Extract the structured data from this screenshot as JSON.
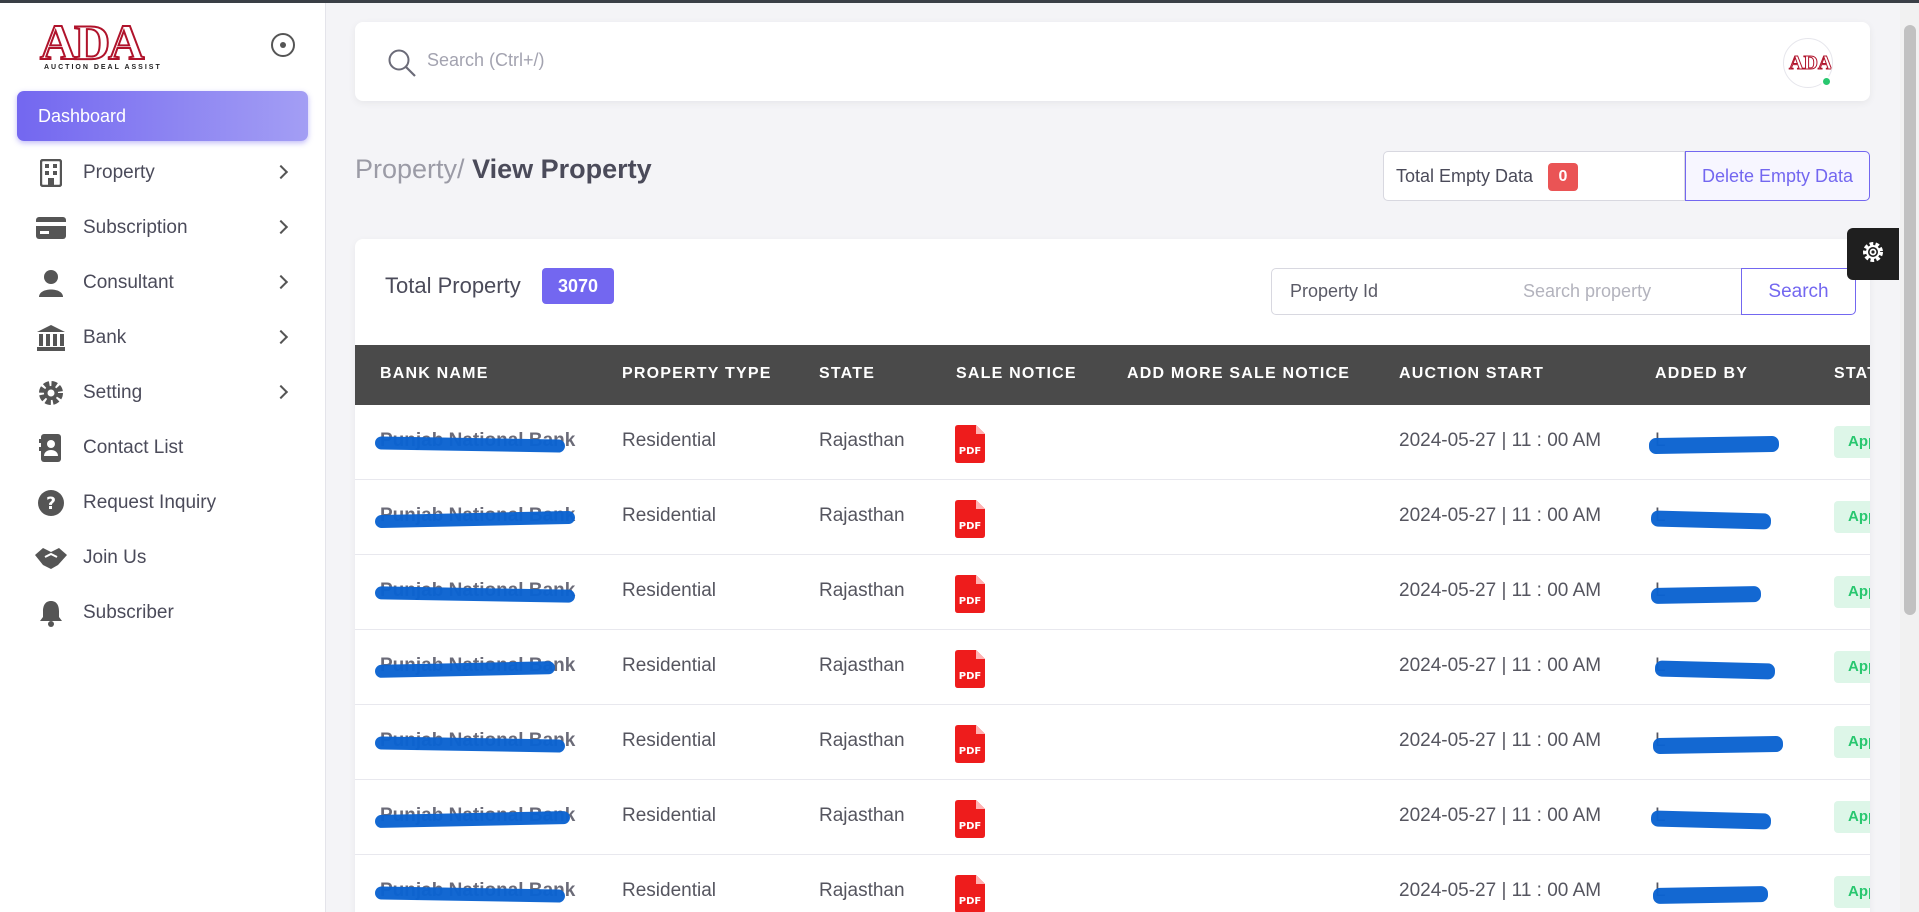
{
  "brand": {
    "logo_text": "ADA",
    "tagline": "AUCTION DEAL ASSIST"
  },
  "sidebar": {
    "active": "Dashboard",
    "items": [
      {
        "label": "Property",
        "icon": "building-icon",
        "has_submenu": true
      },
      {
        "label": "Subscription",
        "icon": "credit-card-icon",
        "has_submenu": true
      },
      {
        "label": "Consultant",
        "icon": "user-icon",
        "has_submenu": true
      },
      {
        "label": "Bank",
        "icon": "bank-icon",
        "has_submenu": true
      },
      {
        "label": "Setting",
        "icon": "gear-icon",
        "has_submenu": true
      },
      {
        "label": "Contact List",
        "icon": "contact-card-icon",
        "has_submenu": false
      },
      {
        "label": "Request Inquiry",
        "icon": "question-icon",
        "has_submenu": false
      },
      {
        "label": "Join Us",
        "icon": "handshake-icon",
        "has_submenu": false
      },
      {
        "label": "Subscriber",
        "icon": "bell-icon",
        "has_submenu": false
      }
    ]
  },
  "topbar": {
    "search_placeholder": "Search (Ctrl+/)"
  },
  "breadcrumb": {
    "parent": "Property/",
    "current": "View Property"
  },
  "empty_data": {
    "label": "Total Empty Data",
    "count": "0",
    "delete_label": "Delete Empty Data"
  },
  "property_card": {
    "total_label": "Total Property",
    "total_count": "3070",
    "filter": {
      "id_placeholder": "Property Id",
      "search_placeholder": "Search property",
      "button": "Search"
    },
    "columns": [
      "BANK NAME",
      "PROPERTY TYPE",
      "STATE",
      "SALE NOTICE",
      "ADD MORE SALE NOTICE",
      "AUCTION START",
      "ADDED BY",
      "STATUS"
    ],
    "rows": [
      {
        "bank": "Punjab National Bank",
        "type": "Residential",
        "state": "Rajasthan",
        "sale_notice": "PDF",
        "auction_start": "2024-05-27 | 11 : 00 AM",
        "added_by": "L",
        "status": "Approved"
      },
      {
        "bank": "Punjab National Bank",
        "type": "Residential",
        "state": "Rajasthan",
        "sale_notice": "PDF",
        "auction_start": "2024-05-27 | 11 : 00 AM",
        "added_by": "L",
        "status": "Approved"
      },
      {
        "bank": "Punjab National Bank",
        "type": "Residential",
        "state": "Rajasthan",
        "sale_notice": "PDF",
        "auction_start": "2024-05-27 | 11 : 00 AM",
        "added_by": "L",
        "status": "Approved"
      },
      {
        "bank": "Punjab National Bank",
        "type": "Residential",
        "state": "Rajasthan",
        "sale_notice": "PDF",
        "auction_start": "2024-05-27 | 11 : 00 AM",
        "added_by": "L",
        "status": "Approved"
      },
      {
        "bank": "Punjab National Bank",
        "type": "Residential",
        "state": "Rajasthan",
        "sale_notice": "PDF",
        "auction_start": "2024-05-27 | 11 : 00 AM",
        "added_by": "L",
        "status": "Approved"
      },
      {
        "bank": "Punjab National Bank",
        "type": "Residential",
        "state": "Rajasthan",
        "sale_notice": "PDF",
        "auction_start": "2024-05-27 | 11 : 00 AM",
        "added_by": "L",
        "status": "Approved"
      },
      {
        "bank": "Punjab National Bank",
        "type": "Residential",
        "state": "Rajasthan",
        "sale_notice": "PDF",
        "auction_start": "2024-05-27 | 11 : 00 AM",
        "added_by": "L",
        "status": "Approved"
      }
    ]
  },
  "colors": {
    "accent": "#7367f0",
    "danger": "#ea5455",
    "success": "#28c76f",
    "table_header": "#4a4a4a",
    "redaction": "#0b63d1"
  }
}
